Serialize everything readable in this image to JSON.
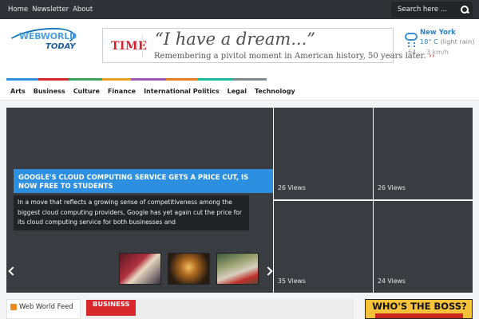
{
  "top_nav": {
    "items": [
      "Home",
      "Newsletter",
      "About"
    ]
  },
  "search": {
    "placeholder": "Search here ..."
  },
  "logo": {
    "name_a": "WEB",
    "name_b": "WORLD",
    "tagline": "TODAY"
  },
  "ad": {
    "brand": "TIME",
    "headline": "“I have a dream...”",
    "subtext": "Remembering a pivitol moment in American history, 50 years later.",
    "more": "››"
  },
  "weather": {
    "city": "New York",
    "temp": "18° C",
    "condition": "(light rain)",
    "humidity": "64",
    "wind": "3 km/h",
    "accent": "#2e7fc2"
  },
  "categories": {
    "items": [
      "Arts",
      "Business",
      "Culture",
      "Finance",
      "International Politics",
      "Legal",
      "Technology"
    ],
    "colors": [
      "#2d8fe0",
      "#d8282e",
      "#3aa35b",
      "#f0a020",
      "#9b59b6",
      "#e67e22",
      "#1abc9c",
      "#7f8c8d"
    ]
  },
  "featured": {
    "title": "Google's cloud computing service gets a price cut, is now free to students",
    "excerpt": "In a move that reflects a growing sense of competitiveness among the biggest cloud computing providers, Google has yet again cut the price for its cloud computing service for both businesses and"
  },
  "tiles": [
    {
      "views": "26 Views"
    },
    {
      "views": "26 Views"
    },
    {
      "views": "35 Views"
    },
    {
      "views": "24 Views"
    }
  ],
  "widgets": {
    "feed_label": "Web World Feed",
    "business_tag": "BUSINESS",
    "boss_ad": "WHO'S THE BOSS?"
  },
  "colors": {
    "topbar": "#2f3236",
    "accent_blue": "#2d8fe0",
    "business_red": "#d8282e",
    "tile_dark": "#393c41"
  }
}
